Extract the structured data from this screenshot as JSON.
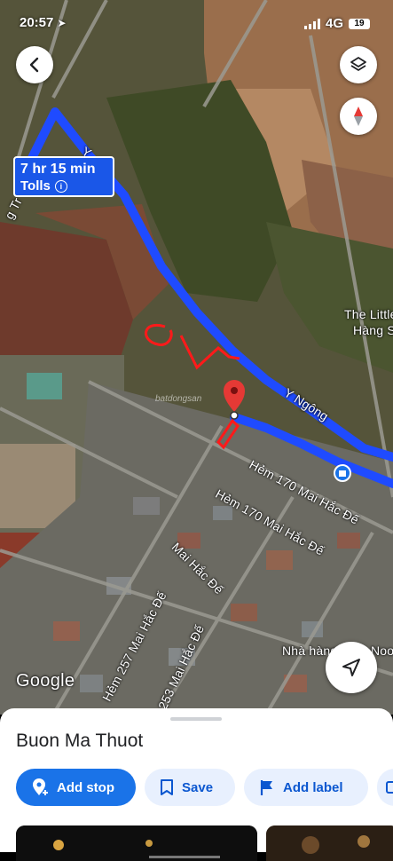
{
  "status_bar": {
    "time": "20:57",
    "network": "4G",
    "battery": "19"
  },
  "map": {
    "route_info": {
      "duration": "7 hr 15 min",
      "tolls": "Tolls"
    },
    "labels": {
      "street_y_ngong": "Y Ngông",
      "hem_170_a": "Hẻm 170 Mai Hắc Đế",
      "hem_170_b": "Hẻm 170 Mai Hắc Đế",
      "mai_hac_de": "Mai Hắc Đế",
      "hem_257": "Hẻm 257 Mai Hắc Đế",
      "hem_253": "253 Mai Hắc Đế",
      "place_little": "The Little",
      "place_hang": "Hàng S",
      "nha_hang": "Nhà hàng",
      "noon": "Noo",
      "left_street": "g Tr",
      "top_street": "Y"
    },
    "google_logo": "Google",
    "watermark": "batdongsan",
    "icons": {
      "back": "arrow-left-icon",
      "layers": "layers-icon",
      "compass": "compass-icon",
      "navigate": "navigation-arrow-icon"
    },
    "colors": {
      "route": "#1f4bff",
      "route_box": "#1a57e8",
      "pin": "#e53935",
      "annotation": "#ff1a1a"
    }
  },
  "sheet": {
    "title": "Buon Ma Thuot",
    "actions": [
      {
        "label": "Add stop",
        "icon": "add-location-icon"
      },
      {
        "label": "Save",
        "icon": "bookmark-icon"
      },
      {
        "label": "Add label",
        "icon": "flag-icon"
      },
      {
        "label": "",
        "icon": "more-icon"
      }
    ],
    "accent": "#1a73e8"
  }
}
